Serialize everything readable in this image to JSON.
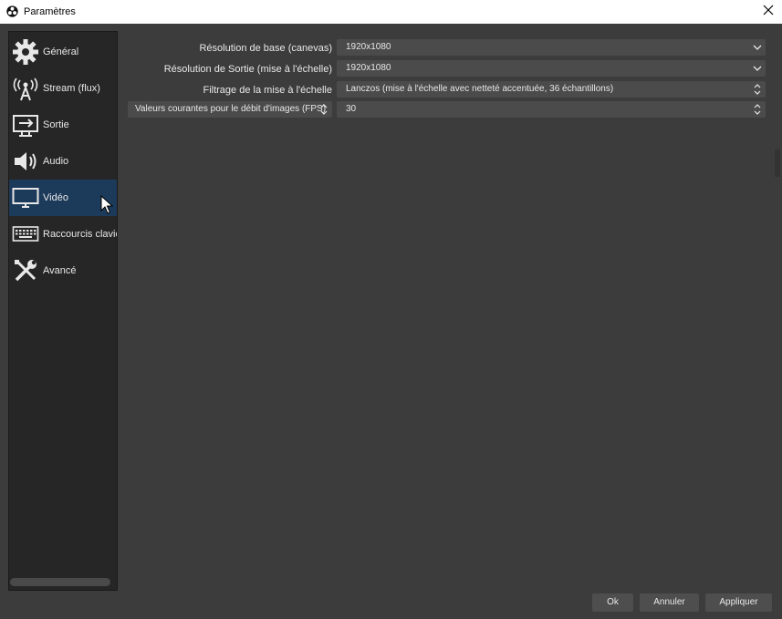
{
  "window": {
    "title": "Paramètres"
  },
  "sidebar": {
    "items": [
      {
        "label": "Général",
        "icon": "gear-icon"
      },
      {
        "label": "Stream (flux)",
        "icon": "broadcast-icon"
      },
      {
        "label": "Sortie",
        "icon": "output-icon"
      },
      {
        "label": "Audio",
        "icon": "speaker-icon"
      },
      {
        "label": "Vidéo",
        "icon": "monitor-icon",
        "selected": true
      },
      {
        "label": "Raccourcis clavier",
        "icon": "keyboard-icon"
      },
      {
        "label": "Avancé",
        "icon": "tools-icon"
      }
    ]
  },
  "video": {
    "base_resolution": {
      "label": "Résolution de base (canevas)",
      "value": "1920x1080"
    },
    "output_resolution": {
      "label": "Résolution de Sortie (mise à l'échelle)",
      "value": "1920x1080"
    },
    "downscale_filter": {
      "label": "Filtrage de la mise à l'échelle",
      "value": "Lanczos (mise à l'échelle avec netteté accentuée, 36 échantillons)"
    },
    "fps": {
      "type_label": "Valeurs courantes pour le débit d'images (FPS)",
      "value": "30"
    }
  },
  "buttons": {
    "ok": "Ok",
    "cancel": "Annuler",
    "apply": "Appliquer"
  },
  "colors": {
    "selected": "#1c3a5a",
    "background": "#3c3c3c",
    "sidebar": "#262626",
    "field": "#4b4b4b"
  }
}
